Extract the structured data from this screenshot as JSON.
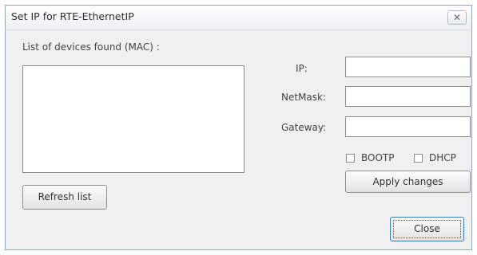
{
  "window": {
    "title": "Set IP for RTE-EthernetIP",
    "close_glyph": "✕"
  },
  "devices": {
    "label": "List of devices found (MAC) :",
    "items": [],
    "refresh_label": "Refresh list"
  },
  "settings": {
    "ip_label": "IP:",
    "ip_value": "",
    "netmask_label": "NetMask:",
    "netmask_value": "",
    "gateway_label": "Gateway:",
    "gateway_value": "",
    "bootp_label": "BOOTP",
    "bootp_checked": false,
    "dhcp_label": "DHCP",
    "dhcp_checked": false,
    "apply_label": "Apply changes"
  },
  "footer": {
    "close_label": "Close"
  }
}
